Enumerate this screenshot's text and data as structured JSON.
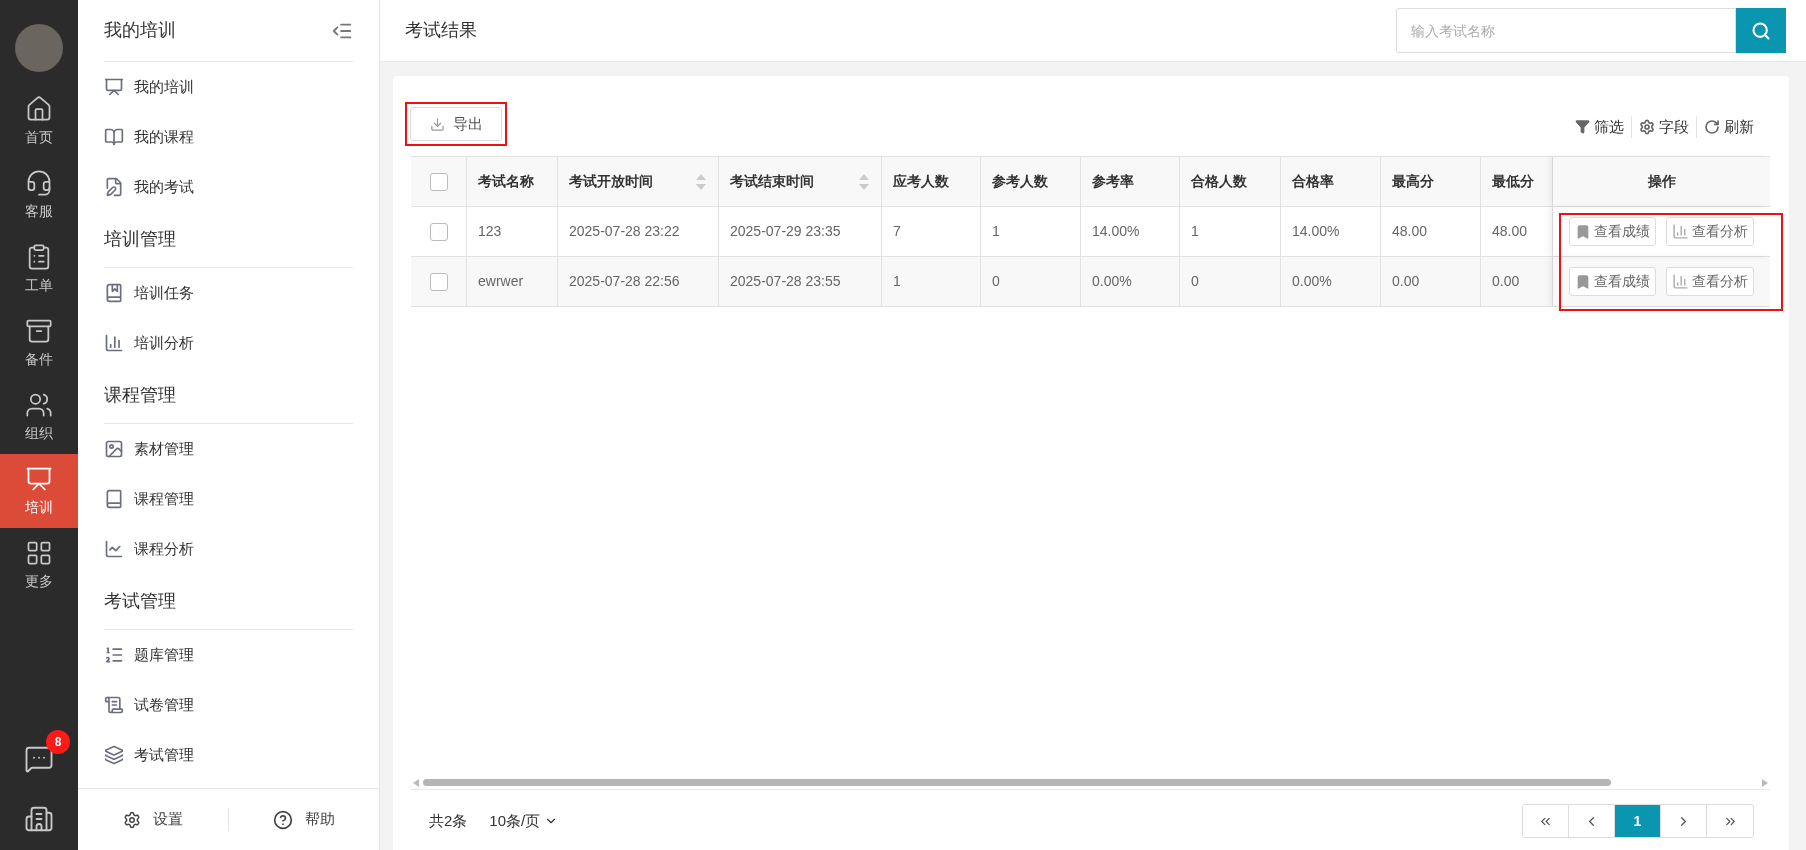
{
  "rail": {
    "items": [
      {
        "label": "首页",
        "selected": false
      },
      {
        "label": "客服",
        "selected": false
      },
      {
        "label": "工单",
        "selected": false
      },
      {
        "label": "备件",
        "selected": false
      },
      {
        "label": "组织",
        "selected": false
      },
      {
        "label": "培训",
        "selected": true
      },
      {
        "label": "更多",
        "selected": false
      }
    ],
    "chat_badge": "8"
  },
  "sidebar": {
    "title": "我的培训",
    "sections": [
      {
        "items": [
          {
            "label": "我的培训"
          },
          {
            "label": "我的课程"
          },
          {
            "label": "我的考试"
          }
        ]
      },
      {
        "heading": "培训管理",
        "items": [
          {
            "label": "培训任务"
          },
          {
            "label": "培训分析"
          }
        ]
      },
      {
        "heading": "课程管理",
        "items": [
          {
            "label": "素材管理"
          },
          {
            "label": "课程管理"
          },
          {
            "label": "课程分析"
          }
        ]
      },
      {
        "heading": "考试管理",
        "items": [
          {
            "label": "题库管理"
          },
          {
            "label": "试卷管理"
          },
          {
            "label": "考试管理"
          }
        ]
      }
    ],
    "footer": [
      "设置",
      "帮助"
    ]
  },
  "header": {
    "title": "考试结果",
    "search": {
      "placeholder": "输入考试名称"
    }
  },
  "toolbar": {
    "export": "导出",
    "tools": [
      "筛选",
      "字段",
      "刷新"
    ]
  },
  "table": {
    "columns": [
      {
        "label": "考试名称",
        "sortable": false
      },
      {
        "label": "考试开放时间",
        "sortable": true
      },
      {
        "label": "考试结束时间",
        "sortable": true
      },
      {
        "label": "应考人数",
        "sortable": false
      },
      {
        "label": "参考人数",
        "sortable": false
      },
      {
        "label": "参考率",
        "sortable": false
      },
      {
        "label": "合格人数",
        "sortable": false
      },
      {
        "label": "合格率",
        "sortable": false
      },
      {
        "label": "最高分",
        "sortable": false
      },
      {
        "label": "最低分",
        "sortable": false
      }
    ],
    "actions_heading": "操作",
    "all_checked": false,
    "rows": [
      {
        "checked": false,
        "cells": [
          "123",
          "2025-07-28 23:22",
          "2025-07-29 23:35",
          "7",
          "1",
          "14.00%",
          "1",
          "14.00%",
          "48.00",
          "48.00"
        ],
        "actions": [
          "查看成绩",
          "查看分析"
        ]
      },
      {
        "checked": false,
        "cells": [
          "ewrwer",
          "2025-07-28 22:56",
          "2025-07-28 23:55",
          "1",
          "0",
          "0.00%",
          "0",
          "0.00%",
          "0.00",
          "0.00"
        ],
        "actions": [
          "查看成绩",
          "查看分析"
        ]
      }
    ]
  },
  "footer": {
    "total": "共2条",
    "page_size": "10条/页",
    "pages": [
      {
        "label": "1",
        "selected": true
      }
    ]
  }
}
